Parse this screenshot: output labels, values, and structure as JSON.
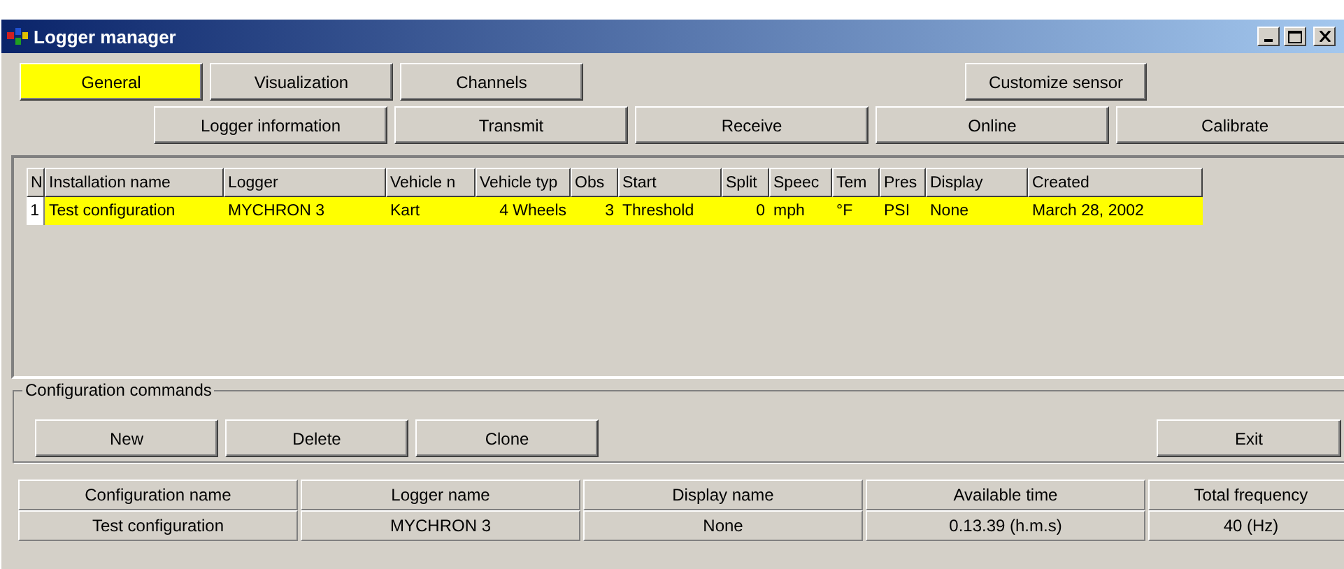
{
  "window": {
    "title": "Logger manager"
  },
  "tabs": [
    {
      "label": "General",
      "selected": true
    },
    {
      "label": "Visualization",
      "selected": false
    },
    {
      "label": "Channels",
      "selected": false
    }
  ],
  "customize_button": "Customize sensor",
  "subtabs": [
    {
      "label": "Logger information",
      "selected": false
    },
    {
      "label": "Transmit",
      "selected": false
    },
    {
      "label": "Receive",
      "selected": false
    },
    {
      "label": "Online",
      "selected": false
    },
    {
      "label": "Calibrate",
      "selected": false
    }
  ],
  "table": {
    "columns": [
      "N",
      "Installation name",
      "Logger",
      "Vehicle n",
      "Vehicle typ",
      "Obs",
      "Start",
      "Split",
      "Speec",
      "Tem",
      "Pres",
      "Display",
      "Created"
    ],
    "rows": [
      {
        "selected": true,
        "cells": [
          "1",
          "Test configuration",
          "MYCHRON 3",
          "Kart",
          "4 Wheels",
          "3",
          "Threshold",
          "0",
          "mph",
          "°F",
          "PSI",
          "None",
          "March 28, 2002"
        ]
      }
    ]
  },
  "commands": {
    "title": "Configuration commands",
    "buttons": [
      "New",
      "Delete",
      "Clone"
    ],
    "exit": "Exit"
  },
  "status": {
    "headers": [
      "Configuration name",
      "Logger name",
      "Display name",
      "Available time",
      "Total frequency"
    ],
    "values": [
      "Test configuration",
      "MYCHRON 3",
      "None",
      "0.13.39 (h.m.s)",
      "40 (Hz)"
    ]
  }
}
